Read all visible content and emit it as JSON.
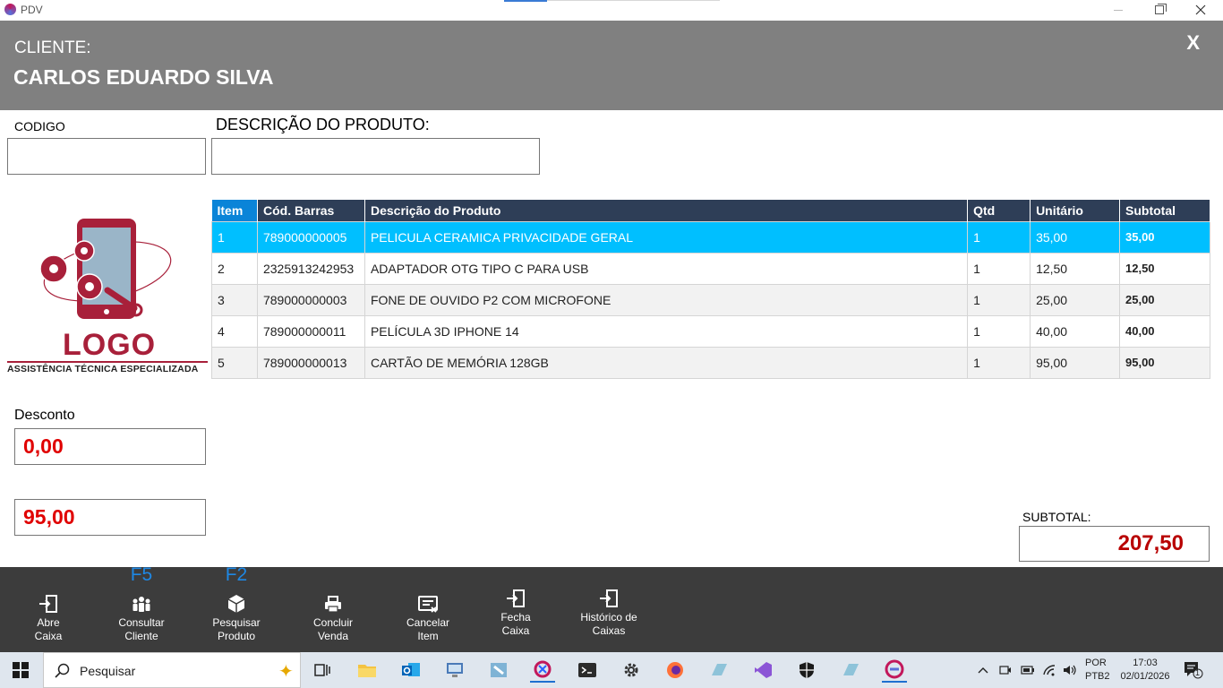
{
  "window": {
    "title": "PDV"
  },
  "header": {
    "cliente_label": "CLIENTE:",
    "cliente_name": "CARLOS EDUARDO SILVA",
    "close_label": "X"
  },
  "fields": {
    "codigo_label": "CODIGO",
    "descricao_label": "DESCRIÇÃO DO PRODUTO:",
    "codigo_value": "",
    "descricao_value": ""
  },
  "logo": {
    "text": "LOGO",
    "subtitle": "ASSISTÊNCIA TÉCNICA ESPECIALIZADA",
    "color": "#a8203a"
  },
  "grid": {
    "columns": [
      "Item",
      "Cód. Barras",
      "Descrição do Produto",
      "Qtd",
      "Unitário",
      "Subtotal"
    ],
    "rows": [
      [
        "1",
        "789000000005",
        "PELICULA CERAMICA PRIVACIDADE GERAL",
        "1",
        "35,00",
        "35,00"
      ],
      [
        "2",
        "2325913242953",
        "ADAPTADOR OTG TIPO C PARA USB",
        "1",
        "12,50",
        "12,50"
      ],
      [
        "3",
        "789000000003",
        "FONE DE OUVIDO P2 COM MICROFONE",
        "1",
        "25,00",
        "25,00"
      ],
      [
        "4",
        "789000000011",
        "PELÍCULA 3D IPHONE 14",
        "1",
        "40,00",
        "40,00"
      ],
      [
        "5",
        "789000000013",
        "CARTÃO DE MEMÓRIA 128GB",
        "1",
        "95,00",
        "95,00"
      ]
    ],
    "selected_row": 0,
    "header_color": "#2e3e57",
    "selected_color": "#00bfff"
  },
  "desconto": {
    "label": "Desconto",
    "value": "0,00"
  },
  "total": {
    "value": "95,00"
  },
  "subtotal": {
    "label": "SUBTOTAL:",
    "value": "207,50"
  },
  "toolbar": {
    "buttons": [
      {
        "line1": "Abre",
        "line2": "Caixa",
        "fkey": "",
        "icon": "enter-icon"
      },
      {
        "line1": "Consultar",
        "line2": "Cliente",
        "fkey": "F5",
        "icon": "users-icon"
      },
      {
        "line1": "Pesquisar",
        "line2": "Produto",
        "fkey": "F2",
        "icon": "box-icon"
      },
      {
        "line1": "Concluir",
        "line2": "Venda",
        "fkey": "",
        "icon": "printer-icon"
      },
      {
        "line1": "Cancelar",
        "line2": "Item",
        "fkey": "",
        "icon": "cancel-item-icon"
      },
      {
        "line1": "Fecha",
        "line2": "Caixa",
        "fkey": "",
        "icon": "exit-icon"
      },
      {
        "line1": "Histórico de",
        "line2": "Caixas",
        "fkey": "",
        "icon": "history-icon"
      }
    ]
  },
  "taskbar": {
    "search_placeholder": "Pesquisar",
    "lang1": "POR",
    "lang2": "PTB2",
    "time": "17:03",
    "date": "02/01/2026",
    "notification_count": "1"
  }
}
